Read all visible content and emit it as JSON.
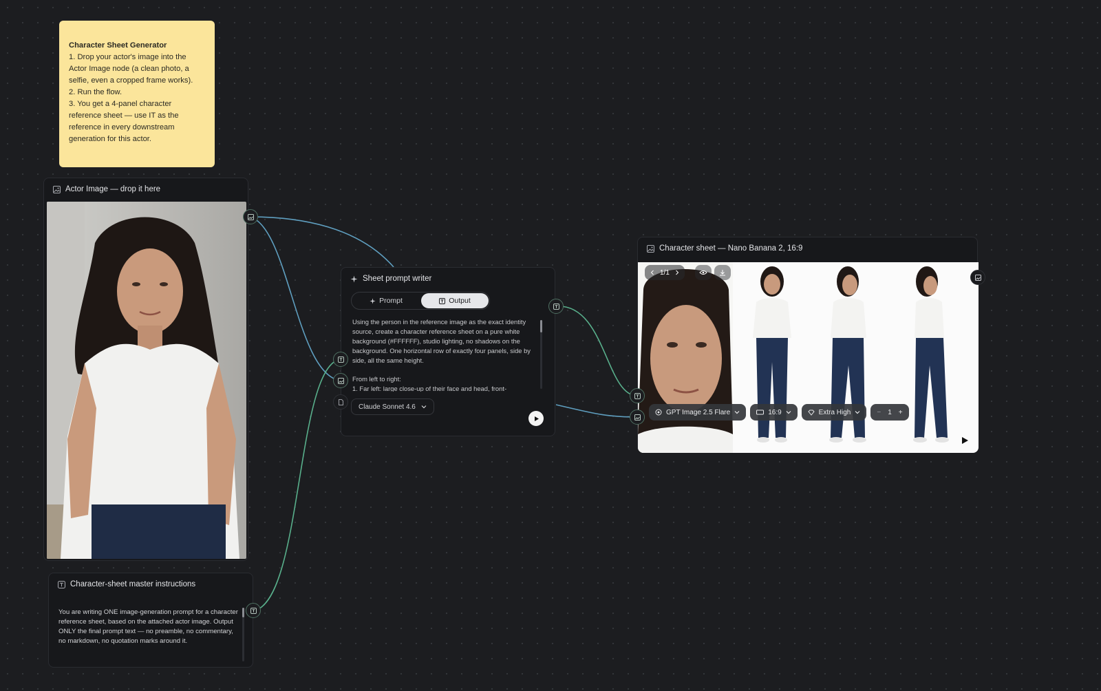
{
  "sticky_note": {
    "title": "Character Sheet Generator",
    "lines": [
      "1. Drop your actor's image into the Actor Image node (a clean photo, a selfie, even a cropped frame works).",
      "2. Run the flow.",
      "3. You get a 4-panel character reference sheet — use IT as the reference in every downstream generation for this actor."
    ]
  },
  "actor_node": {
    "title": "Actor Image — drop it here"
  },
  "writer_node": {
    "title": "Sheet prompt writer",
    "tabs": [
      {
        "label": "Prompt",
        "active": false
      },
      {
        "label": "Output",
        "active": true
      }
    ],
    "output_paragraphs": [
      "Using the person in the reference image as the exact identity source, create a character reference sheet on a pure white background (#FFFFFF), studio lighting, no shadows on the background. One horizontal row of exactly four panels, side by side, all the same height.",
      "From left to right:\n1. Far left: large close-up of their face and head, front-"
    ],
    "model": "Claude Sonnet 4.6"
  },
  "sheet_node": {
    "title": "Character sheet — Nano Banana 2, 16:9",
    "pager": "1/1",
    "toolbar": {
      "model": "GPT Image 2.5 Flare",
      "aspect": "16:9",
      "quality": "Extra High",
      "count": "1"
    }
  },
  "instructions_node": {
    "title": "Character-sheet master instructions",
    "text": "You are writing ONE image-generation prompt for a character reference sheet, based on the attached actor image. Output ONLY the final prompt text — no preamble, no commentary, no markdown, no quotation marks around it."
  },
  "colors": {
    "canvas": "#1c1d20",
    "sticky": "#fbe59b",
    "wire_blue": "#5f9fc0",
    "wire_green": "#59b08c"
  }
}
